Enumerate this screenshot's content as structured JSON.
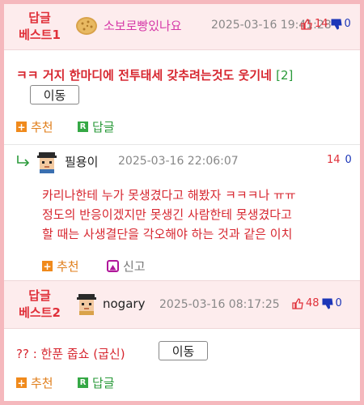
{
  "best1": {
    "label_line1": "답글",
    "label_line2": "베스트1",
    "nickname": "소보로빵있나요",
    "date": "2025-03-16 19:41:28",
    "up_count": "14",
    "down_count": "0",
    "content": "ㅋㅋ 거지 한마디에 전투태세 갖추려는것도 웃기네",
    "reply_count": "[2]",
    "move_label": "이동",
    "recommend_label": "추천",
    "reply_label": "답글"
  },
  "reply1": {
    "nickname": "필용이",
    "date": "2025-03-16 22:06:07",
    "up_count": "14",
    "down_count": "0",
    "lines": [
      "카리나한테 누가 못생겼다고 해봤자 ㅋㅋㅋ나 ㅠㅠ",
      "정도의 반응이겠지만 못생긴 사람한테 못생겼다고",
      "할 때는 사생결단을 각오해야 하는 것과 같은 이치"
    ],
    "recommend_label": "추천",
    "report_label": "신고"
  },
  "best2": {
    "label_line1": "답글",
    "label_line2": "베스트2",
    "nickname": "nogary",
    "date": "2025-03-16 08:17:25",
    "up_count": "48",
    "down_count": "0",
    "content": "?? : 한푼 줍쇼 (굽신)",
    "move_label": "이동",
    "recommend_label": "추천",
    "reply_label": "답글"
  },
  "colors": {
    "frame": "#f5b8bd",
    "header_bg": "#fdeced",
    "accent_red": "#e0303a",
    "down_blue": "#1c36b8",
    "green": "#2a9a3a",
    "orange": "#e07e1a"
  },
  "icons": [
    "bread-avatar-icon",
    "pixel-avatar-icon",
    "thumbs-up-icon",
    "thumbs-down-icon",
    "reply-arrow-icon",
    "plus-icon",
    "r-icon",
    "report-icon"
  ]
}
